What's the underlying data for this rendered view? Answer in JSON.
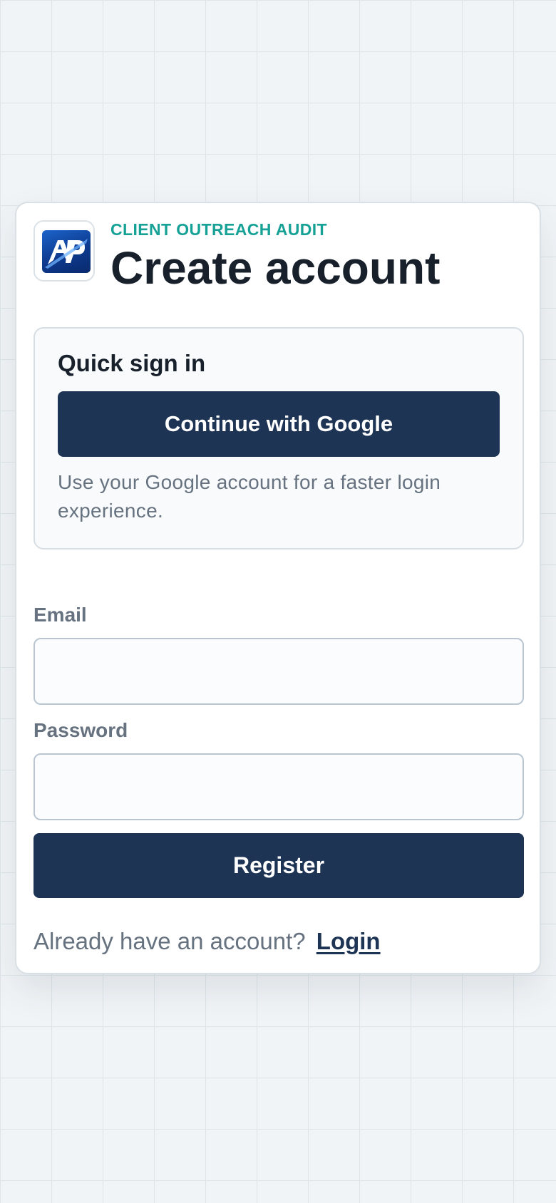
{
  "header": {
    "logo": {
      "icon": "ap-logo-icon",
      "text": "AP"
    },
    "eyebrow": "CLIENT OUTREACH AUDIT",
    "title": "Create account"
  },
  "quick_sign_in": {
    "title": "Quick sign in",
    "google_button": "Continue with Google",
    "description": "Use your Google account for a faster login experience."
  },
  "form": {
    "email_label": "Email",
    "email_value": "",
    "email_placeholder": "",
    "password_label": "Password",
    "password_value": "",
    "password_placeholder": "",
    "register_button": "Register"
  },
  "footer": {
    "prompt": "Already have an account?",
    "login_link": "Login"
  },
  "colors": {
    "primary": "#1e3455",
    "accent": "#15a196",
    "text": "#17202b",
    "muted": "#66727f",
    "background": "#f1f4f7"
  }
}
